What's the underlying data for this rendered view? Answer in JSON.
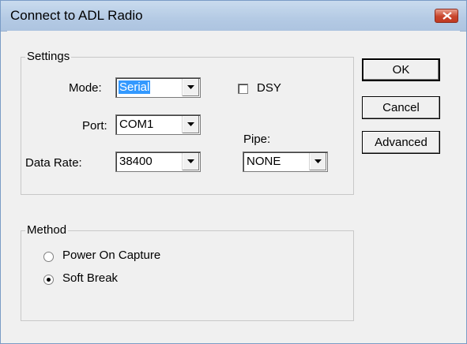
{
  "window": {
    "title": "Connect to ADL Radio",
    "close_icon": "close-icon"
  },
  "settings": {
    "legend": "Settings",
    "mode_label": "Mode:",
    "mode_value": "Serial",
    "port_label": "Port:",
    "port_value": "COM1",
    "rate_label": "Data Rate:",
    "rate_value": "38400",
    "dsy_label": "DSY",
    "dsy_checked": false,
    "pipe_label": "Pipe:",
    "pipe_value": "NONE"
  },
  "method": {
    "legend": "Method",
    "options": [
      {
        "label": "Power On Capture",
        "selected": false
      },
      {
        "label": "Soft Break",
        "selected": true
      }
    ]
  },
  "buttons": {
    "ok": "OK",
    "cancel": "Cancel",
    "advanced": "Advanced"
  },
  "colors": {
    "selection": "#3399ff",
    "close_button": "#c8452b",
    "titlebar": "#b4cae4"
  }
}
